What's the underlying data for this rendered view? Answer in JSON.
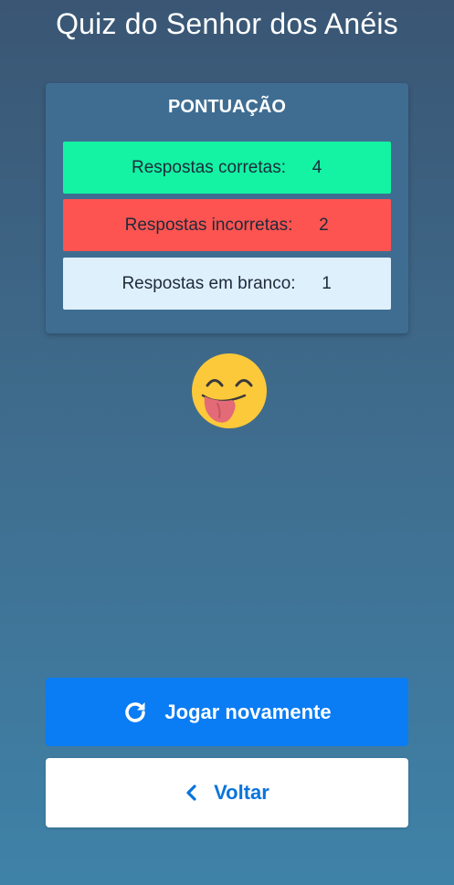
{
  "header": {
    "title": "Quiz do Senhor dos Anéis"
  },
  "score": {
    "title": "PONTUAÇÃO",
    "rows": [
      {
        "label": "Respostas corretas:",
        "value": "4",
        "color": "#13f3a3"
      },
      {
        "label": "Respostas incorretas:",
        "value": "2",
        "color": "#fd5451"
      },
      {
        "label": "Respostas em branco:",
        "value": "1",
        "color": "#dff0fd"
      }
    ]
  },
  "result": {
    "emoji_icon": "face-with-tongue-icon"
  },
  "actions": {
    "play_again_label": "Jogar novamente",
    "play_again_icon": "refresh-icon",
    "play_again_color": "#0a7cf4",
    "back_label": "Voltar",
    "back_icon": "chevron-left-icon",
    "back_color": "#0a74dc"
  }
}
